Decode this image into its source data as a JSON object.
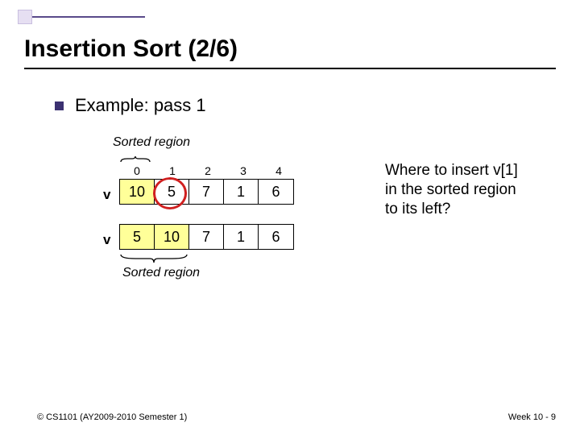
{
  "title": "Insertion Sort (2/6)",
  "bullet": "Example: pass 1",
  "sorted_top_label": "Sorted region",
  "sorted_bot_label": "Sorted region",
  "indices": [
    "0",
    "1",
    "2",
    "3",
    "4"
  ],
  "array_label": "v",
  "array1": {
    "cells": [
      "10",
      "5",
      "7",
      "1",
      "6"
    ],
    "sorted_len": 1
  },
  "array2": {
    "cells": [
      "5",
      "10",
      "7",
      "1",
      "6"
    ],
    "sorted_len": 2
  },
  "side_note_l1": "Where to insert v[1]",
  "side_note_l2": "in the sorted region",
  "side_note_l3": "to its left?",
  "footer_left": "© CS1101 (AY2009-2010 Semester 1)",
  "footer_right": "Week 10 - 9"
}
